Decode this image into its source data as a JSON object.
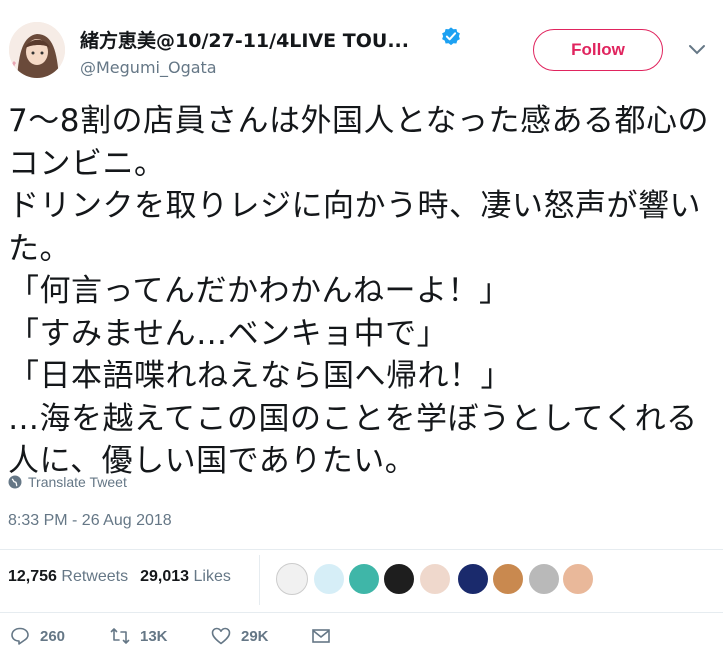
{
  "author": {
    "display_name": "緒方恵美@10/27-11/4LIVE TOU...",
    "handle": "@Megumi_Ogata",
    "verified": true
  },
  "follow_button": {
    "label": "Follow"
  },
  "tweet": {
    "text": "7〜8割の店員さんは外国人となった感ある都心のコンビニ。\nドリンクを取りレジに向かう時、凄い怒声が響いた。\n「何言ってんだかわかんねーよ！」\n「すみません…ベンキョ中で」\n「日本語喋れねえなら国へ帰れ！」\n…海を越えてこの国のことを学ぼうとしてくれる人に、優しい国でありたい。",
    "translate_label": "Translate Tweet",
    "timestamp": "8:33 PM - 26 Aug 2018"
  },
  "stats": {
    "retweets_count": "12,756",
    "retweets_label": "Retweets",
    "likes_count": "29,013",
    "likes_label": "Likes"
  },
  "actions": {
    "reply_count": "260",
    "retweet_count": "13K",
    "like_count": "29K"
  },
  "colors": {
    "accent": "#e0245e",
    "verified": "#1da1f2",
    "secondary_text": "#657786"
  },
  "icons": [
    "verified-icon",
    "chevron-down-icon",
    "globe-icon",
    "reply-icon",
    "retweet-icon",
    "like-icon",
    "message-icon"
  ]
}
